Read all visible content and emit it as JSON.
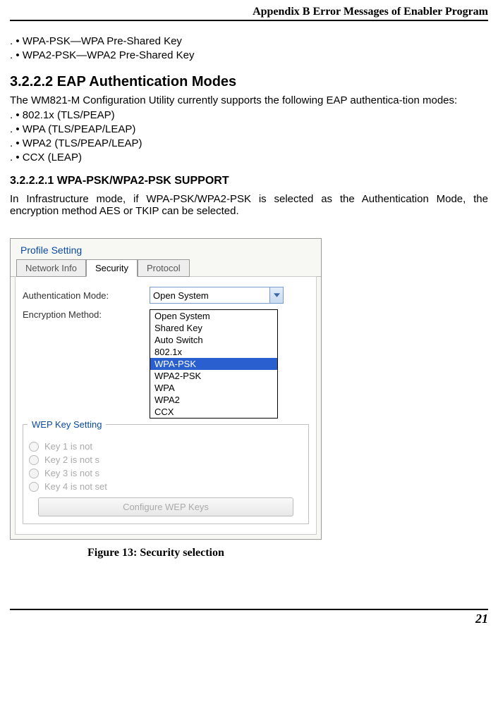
{
  "header": {
    "title": "Appendix B Error Messages of Enabler Program"
  },
  "top_bullets": [
    ".        • WPA-PSK—WPA Pre-Shared Key",
    ".        • WPA2-PSK—WPA2 Pre-Shared Key"
  ],
  "section_3_2_2_2": {
    "heading": "3.2.2.2 EAP Authentication Modes",
    "intro": "The WM821-M Configuration Utility currently supports the following EAP authentica-tion modes:",
    "bullets": [
      ".        • 802.1x (TLS/PEAP)",
      ".        • WPA (TLS/PEAP/LEAP)",
      ".        • WPA2 (TLS/PEAP/LEAP)",
      ".        • CCX (LEAP)"
    ]
  },
  "section_3_2_2_2_1": {
    "heading": "3.2.2.2.1 WPA-PSK/WPA2-PSK SUPPORT",
    "para": "In Infrastructure mode, if WPA-PSK/WPA2-PSK is selected as the Authentication Mode, the encryption method AES or TKIP can be selected."
  },
  "dialog": {
    "title": "Profile Setting",
    "tabs": {
      "network_info": "Network Info",
      "security": "Security",
      "protocol": "Protocol"
    },
    "labels": {
      "auth_mode": "Authentication Mode:",
      "enc_method": "Encryption Method:"
    },
    "auth_combo_value": "Open System",
    "dropdown_options": [
      {
        "label": "Open System",
        "selected": false
      },
      {
        "label": "Shared Key",
        "selected": false
      },
      {
        "label": "Auto Switch",
        "selected": false
      },
      {
        "label": "802.1x",
        "selected": false
      },
      {
        "label": "WPA-PSK",
        "selected": true
      },
      {
        "label": "WPA2-PSK",
        "selected": false
      },
      {
        "label": "WPA",
        "selected": false
      },
      {
        "label": "WPA2",
        "selected": false
      },
      {
        "label": "CCX",
        "selected": false
      }
    ],
    "wep_legend": "WEP Key Setting",
    "wep_keys": [
      "Key 1 is not",
      "Key 2 is not s",
      "Key 3 is not s",
      "Key 4 is not set"
    ],
    "config_button": "Configure WEP Keys"
  },
  "figure_caption_prefix": "Figure 13: ",
  "figure_caption_text": "Security selection",
  "page_number": "21"
}
